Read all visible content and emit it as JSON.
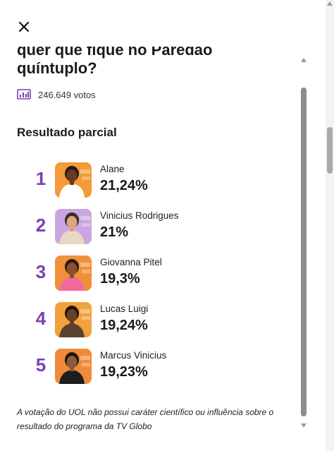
{
  "question": {
    "line1": "quer que fique no Paredão",
    "line2": "quíntuplo?"
  },
  "votes": {
    "icon": "bar-chart-icon",
    "label": "246.649 votos"
  },
  "section_title": "Resultado parcial",
  "results": [
    {
      "rank": "1",
      "name": "Alane",
      "percent": "21,24%",
      "avatar_icon": "person-photo-icon",
      "colors": {
        "bg": "#f39a3a",
        "skin": "#6b3a22",
        "shirt": "#ffffff",
        "hair": "#2a1a12"
      }
    },
    {
      "rank": "2",
      "name": "Vinicius Rodrigues",
      "percent": "21%",
      "avatar_icon": "person-photo-icon",
      "colors": {
        "bg": "#c9a6e0",
        "skin": "#d9a57c",
        "shirt": "#e8d7c3",
        "hair": "#3b2a1e"
      }
    },
    {
      "rank": "3",
      "name": "Giovanna Pitel",
      "percent": "19,3%",
      "avatar_icon": "person-photo-icon",
      "colors": {
        "bg": "#f0913a",
        "skin": "#8a4f2c",
        "shirt": "#f06aa0",
        "hair": "#2a1710"
      }
    },
    {
      "rank": "4",
      "name": "Lucas Luigi",
      "percent": "19,24%",
      "avatar_icon": "person-photo-icon",
      "colors": {
        "bg": "#f2a23c",
        "skin": "#6a3f24",
        "shirt": "#5a4232",
        "hair": "#1e130c"
      }
    },
    {
      "rank": "5",
      "name": "Marcus Vinicius",
      "percent": "19,23%",
      "avatar_icon": "person-photo-icon",
      "colors": {
        "bg": "#f08a3a",
        "skin": "#8c5b3a",
        "shirt": "#1d1d1d",
        "hair": "#1e130c"
      }
    }
  ],
  "disclaimer": "A votação do UOL não possui caráter científico ou influência sobre o resultado do programa da TV Globo",
  "colors": {
    "accent": "#7b3fb5",
    "text": "#1b1b1b"
  }
}
